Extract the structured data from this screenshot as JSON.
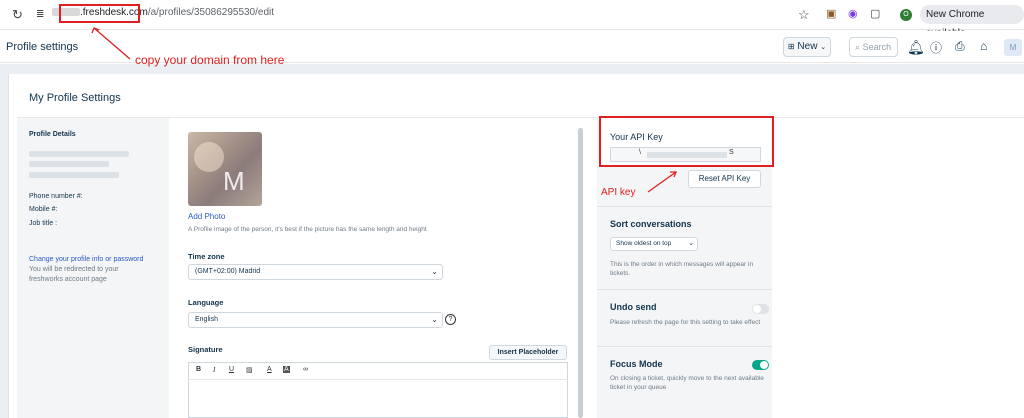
{
  "browser": {
    "url_domain": ".freshdesk.com",
    "url_path": "/a/profiles/35086295530/edit",
    "profile_badge": "O",
    "chrome_button": "New Chrome available"
  },
  "header": {
    "title": "Profile settings",
    "new_button": "New",
    "search_placeholder": "Search",
    "avatar_initial": "M"
  },
  "annotations": {
    "copy_domain": "copy your domain from here",
    "api_key": "API key"
  },
  "page": {
    "title": "My Profile Settings"
  },
  "left_panel": {
    "section_title": "Profile Details",
    "phone_label": "Phone number #:",
    "mobile_label": "Mobile #:",
    "job_label": "Job title :",
    "change_link": "Change your profile info or password",
    "redirect_note": "You will be redirected to your freshworks account page"
  },
  "profile": {
    "photo_initial": "M",
    "add_photo": "Add Photo",
    "photo_note": "A Profile image of the person, it's best if the picture has the same length and height",
    "timezone_label": "Time zone",
    "timezone_value": "(GMT+02:00) Madrid",
    "language_label": "Language",
    "language_value": "English",
    "signature_label": "Signature",
    "insert_placeholder": "Insert Placeholder"
  },
  "editor_toolbar": [
    "B",
    "I",
    "U"
  ],
  "right_col": {
    "api_key_title": "Your API Key",
    "api_key_start": "\\",
    "api_key_end": "S",
    "reset_button": "Reset API Key",
    "sort_title": "Sort conversations",
    "sort_value": "Show oldest on top",
    "sort_note": "This is the order in which messages will appear in tickets.",
    "undo_title": "Undo send",
    "undo_note": "Please refresh the page for this setting to take effect",
    "undo_enabled": false,
    "focus_title": "Focus Mode",
    "focus_note": "On closing a ticket, quickly move to the next available ticket in your queue",
    "focus_enabled": true,
    "toggle_on_color": "#00a886",
    "toggle_off_color": "#dfe3e8"
  },
  "colors": {
    "annotation": "#e02020",
    "link": "#2c5cc5",
    "text": "#12344d"
  }
}
